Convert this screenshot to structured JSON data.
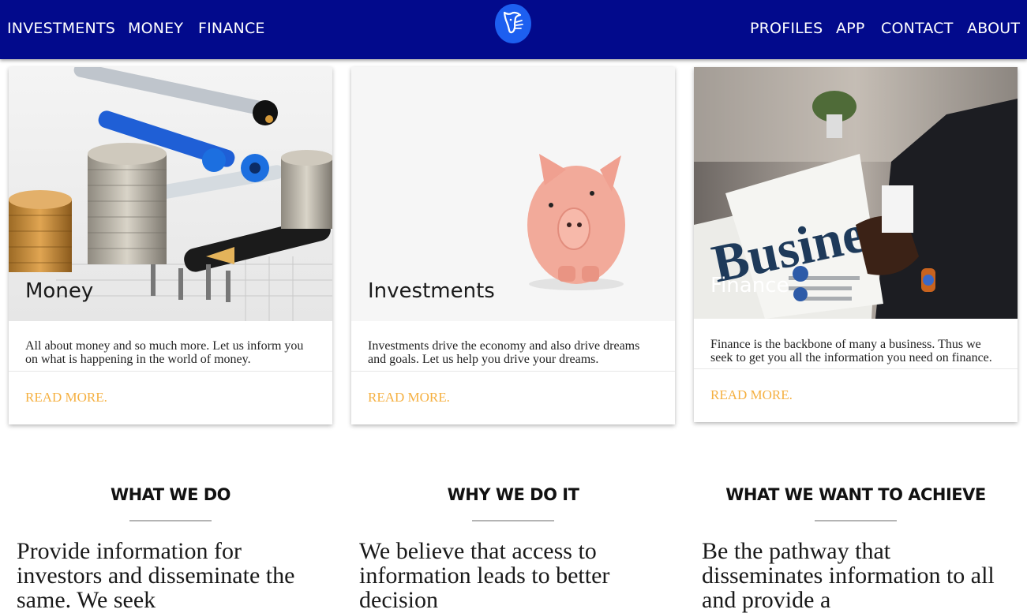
{
  "nav": {
    "left": [
      "INVESTMENTS",
      "MONEY",
      "FINANCE"
    ],
    "right": [
      "PROFILES",
      "APP",
      "CONTACT",
      "ABOUT"
    ],
    "logo_icon": "bull-logo-icon",
    "bg_color": "#020a8c"
  },
  "cards": [
    {
      "title": "Money",
      "text": "All about money and so much more. Let us inform you on what is happening in the world of money.",
      "action": "READ MORE."
    },
    {
      "title": "Investments",
      "text": "Investments drive the economy and also drive dreams and goals. Let us help you drive your dreams.",
      "action": "READ MORE."
    },
    {
      "title": "Finance",
      "text": "Finance is the backbone of many a business. Thus we seek to get you all the information you need on finance.",
      "action": "READ MORE.",
      "newspaper_headline": "Business"
    }
  ],
  "info": [
    {
      "heading": "WHAT WE DO",
      "text": "Provide information for investors and disseminate the same. We seek"
    },
    {
      "heading": "WHY WE DO IT",
      "text": "We believe that access to information leads to better decision"
    },
    {
      "heading": "WHAT WE WANT TO ACHIEVE",
      "text": "Be the pathway that disseminates information to all and provide a"
    }
  ],
  "accent_color": "#f5b041"
}
